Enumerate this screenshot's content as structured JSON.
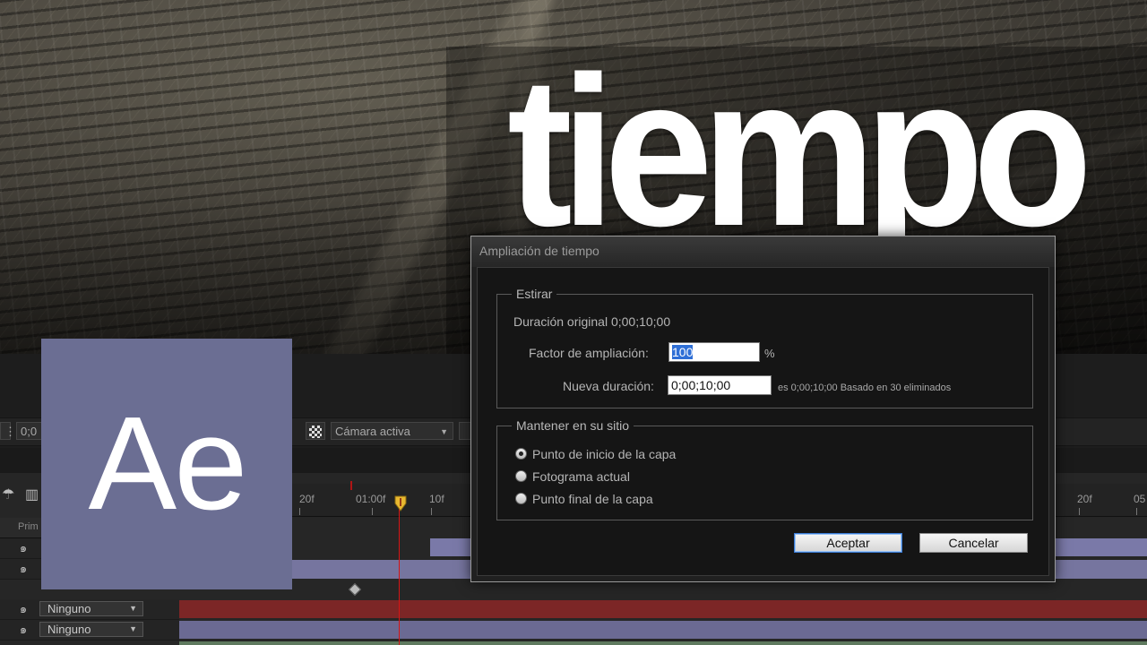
{
  "headline": "tiempo",
  "logo": {
    "text": "Ae",
    "color": "#6b6e93"
  },
  "viewer_toolbar": {
    "time_value": "0;0",
    "camera_label": "Cámara activa"
  },
  "timeline": {
    "column_header": "Prim",
    "ruler_ticks": [
      "20f",
      "01:00f",
      "10f",
      "20f",
      "05"
    ],
    "layer_rows": [
      {
        "parent": ""
      },
      {
        "parent": ""
      },
      {
        "parent": "Ninguno"
      },
      {
        "parent": "Ninguno"
      }
    ],
    "colors": {
      "playhead": "#d61515",
      "bar_lavender": "#7a79a8",
      "bar_red": "#7c2626"
    }
  },
  "dialog": {
    "title": "Ampliación de tiempo",
    "stretch_group": {
      "legend": "Estirar",
      "original_duration_label": "Duración original",
      "original_duration_value": "0;00;10;00",
      "factor_label": "Factor de ampliación:",
      "factor_value": "100",
      "factor_unit": "%",
      "new_duration_label": "Nueva duración:",
      "new_duration_value": "0;00;10;00",
      "new_duration_note": "es 0;00;10;00  Basado en 30 eliminados"
    },
    "hold_group": {
      "legend": "Mantener en su sitio",
      "options": [
        {
          "label": "Punto de inicio de la capa",
          "checked": true
        },
        {
          "label": "Fotograma actual",
          "checked": false
        },
        {
          "label": "Punto final de la capa",
          "checked": false
        }
      ]
    },
    "buttons": {
      "ok": "Aceptar",
      "cancel": "Cancelar"
    }
  }
}
